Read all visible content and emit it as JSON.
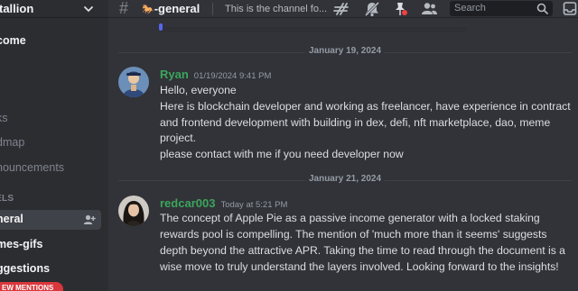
{
  "sidebar": {
    "server_name": "tallion",
    "items": [
      {
        "label": "come",
        "state": "bright"
      },
      {
        "label": "ks",
        "state": "muted"
      },
      {
        "label": "dmap",
        "state": "muted"
      },
      {
        "label": "nouncements",
        "state": "muted"
      }
    ],
    "category": "ELS",
    "channels": [
      {
        "label": "neral",
        "state": "selected"
      },
      {
        "label": "mes-gifs",
        "state": "bright"
      },
      {
        "label": "ggestions",
        "state": "bright"
      }
    ],
    "mentions_pill": "EW MENTIONS"
  },
  "header": {
    "channel_emoji": "🐎",
    "channel_name": "-general",
    "topic": "This is the channel fo...",
    "search_placeholder": "Search",
    "icons": [
      "threads-icon",
      "mute-bell-icon",
      "pin-icon",
      "members-icon",
      "search-icon",
      "inbox-icon"
    ]
  },
  "messages": [
    {
      "date_divider": "January 19, 2024",
      "author": "Ryan",
      "author_color": "#3ba55c",
      "timestamp": "01/19/2024 9:41 PM",
      "lines": [
        "Hello, everyone",
        "Here is blockchain developer and working as freelancer, have experience in contract",
        "and frontend development with building in dex, defi, nft marketplace, dao, meme",
        "project.",
        "please contact with me if you need developer now"
      ]
    },
    {
      "date_divider": "January 21, 2024",
      "author": "redcar003",
      "author_color": "#3ba55c",
      "timestamp": "Today at 5:21 PM",
      "lines": [
        "The concept of Apple Pie as a passive income generator with a locked staking",
        "rewards pool is compelling. The mention of 'much more than it seems' suggests",
        "depth beyond the attractive APR. Taking the time to read through the document is a",
        "wise move to truly understand the layers involved. Looking forward to the insights!"
      ]
    }
  ],
  "colors": {
    "background": "#313338",
    "sidebar": "#2b2d31",
    "accent_red": "#da373c",
    "username_green": "#3ba55c"
  }
}
